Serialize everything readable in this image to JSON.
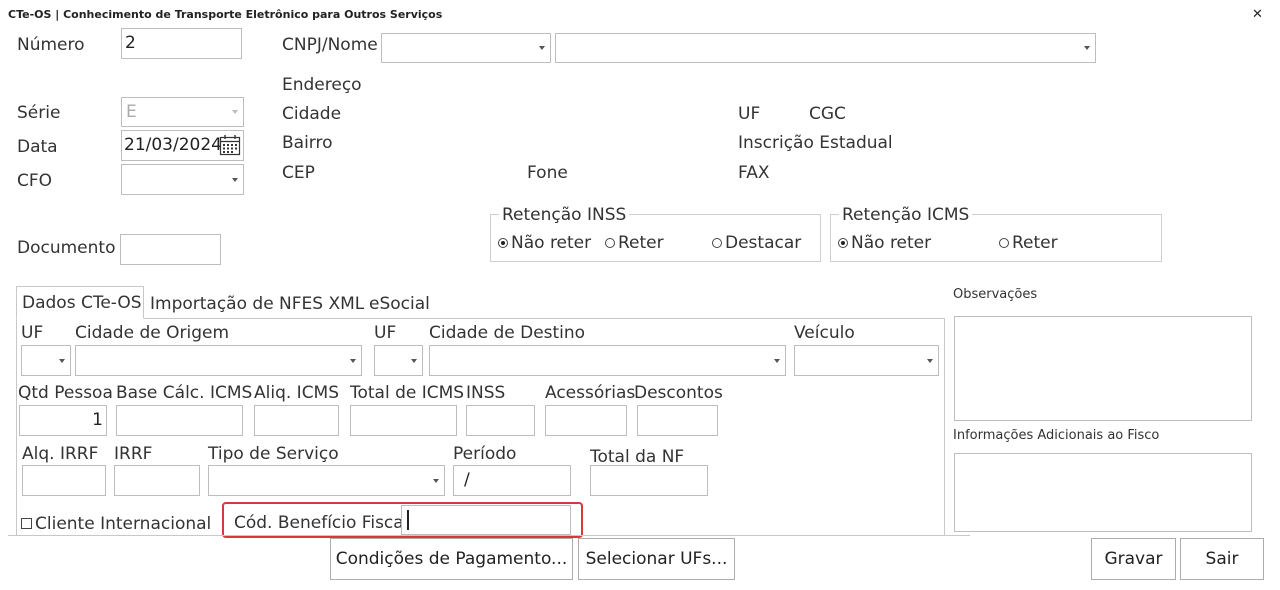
{
  "window": {
    "title": "CTe-OS | Conhecimento de Transporte Eletrônico para Outros Serviços",
    "close_glyph": "✕"
  },
  "header": {
    "numero_label": "Número",
    "numero_value": "2",
    "serie_label": "Série",
    "serie_value": "E",
    "data_label": "Data",
    "data_value": "21/03/2024",
    "cfo_label": "CFO",
    "documento_label": "Documento"
  },
  "cliente": {
    "cnpj_label": "CNPJ/Nome",
    "endereco_label": "Endereço",
    "cidade_label": "Cidade",
    "uf_label": "UF",
    "cgc_label": "CGC",
    "bairro_label": "Bairro",
    "inscricao_label": "Inscrição Estadual",
    "cep_label": "CEP",
    "fone_label": "Fone",
    "fax_label": "FAX"
  },
  "retencao_inss": {
    "title": "Retenção INSS",
    "options": [
      "Não reter",
      "Reter",
      "Destacar"
    ],
    "selected": "Não reter"
  },
  "retencao_icms": {
    "title": "Retenção ICMS",
    "options": [
      "Não reter",
      "Reter"
    ],
    "selected": "Não reter"
  },
  "tabs": [
    "Dados CTe-OS",
    "Importação de NFES XML",
    "eSocial"
  ],
  "dados": {
    "uf_origem_label": "UF",
    "cidade_origem_label": "Cidade de Origem",
    "uf_destino_label": "UF",
    "cidade_destino_label": "Cidade de Destino",
    "veiculo_label": "Veículo",
    "qtd_pessoa_label": "Qtd Pessoa",
    "qtd_pessoa_value": "1",
    "base_calc_label": "Base Cálc. ICMS",
    "aliq_icms_label": "Aliq. ICMS",
    "total_icms_label": "Total de ICMS",
    "inss_label": "INSS",
    "acessorias_label": "Acessórias",
    "descontos_label": "Descontos",
    "aliq_irrf_label": "Alq. IRRF",
    "irrf_label": "IRRF",
    "tipo_servico_label": "Tipo de Serviço",
    "periodo_label": "Período",
    "periodo_value": "/",
    "total_nf_label": "Total da NF",
    "cliente_internacional_label": "Cliente Internacional",
    "cod_beneficio_label": "Cód. Benefício Fiscal"
  },
  "side": {
    "observacoes_label": "Observações",
    "info_adicionais_label": "Informações Adicionais ao Fisco"
  },
  "buttons": {
    "condicoes": "Condições de Pagamento...",
    "selecionar_ufs": "Selecionar UFs...",
    "gravar": "Gravar",
    "sair": "Sair"
  },
  "colors": {
    "highlight": "#d9363e"
  }
}
